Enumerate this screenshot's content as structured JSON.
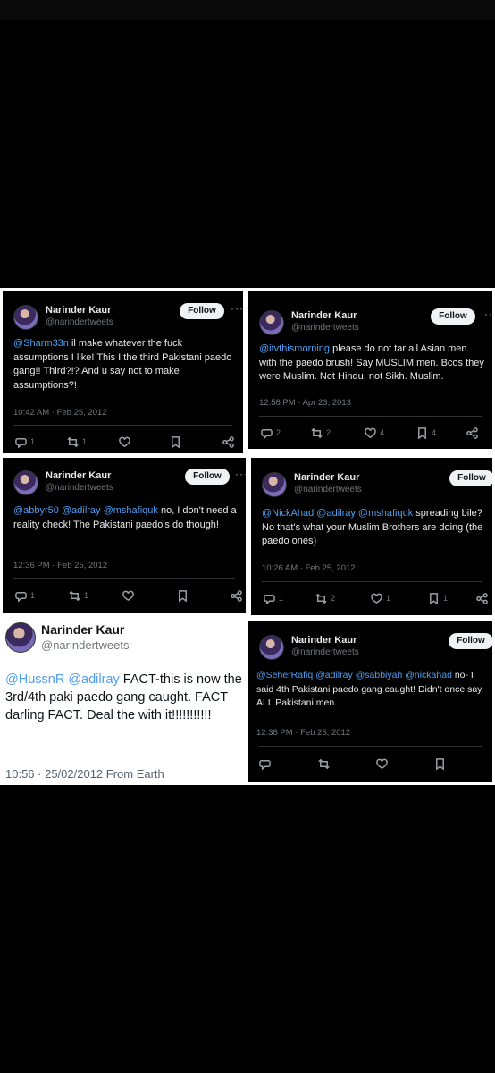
{
  "tweets": [
    {
      "name": "Narinder Kaur",
      "handle": "@narindertweets",
      "follow": "Follow",
      "more": "···",
      "mention": "@Sharm33n",
      "text": " il make whatever the fuck assumptions I like! This I the third Pakistani paedo gang!! Third?!? And u say not to make assumptions?!",
      "timestamp": "10:42 AM · Feb 25, 2012",
      "replies": "1",
      "retweets": "1",
      "likes": "",
      "bookmarks": ""
    },
    {
      "name": "Narinder Kaur",
      "handle": "@narindertweets",
      "follow": "Follow",
      "more": "···",
      "mention": "@itvthismorning",
      "text": " please do not tar all Asian men with the paedo brush! Say MUSLIM men. Bcos they were Muslim. Not Hindu, not Sikh. Muslim.",
      "timestamp": "12:58 PM · Apr 23, 2013",
      "replies": "2",
      "retweets": "2",
      "likes": "4",
      "bookmarks": "4"
    },
    {
      "name": "Narinder Kaur",
      "handle": "@narindertweets",
      "follow": "Follow",
      "more": "···",
      "mention": "@abbyr50 @adilray @mshafiquk",
      "text": " no, I don't need a reality check! The Pakistani paedo's do though!",
      "timestamp": "12:36 PM · Feb 25, 2012",
      "replies": "1",
      "retweets": "1",
      "likes": "",
      "bookmarks": ""
    },
    {
      "name": "Narinder Kaur",
      "handle": "@narindertweets",
      "follow": "Follow",
      "more": "",
      "mention": "@NickAhad @adilray @mshafiquk",
      "text": " spreading bile? No that's what your Muslim Brothers are doing (the paedo ones)",
      "timestamp": "10:26 AM · Feb 25, 2012",
      "replies": "1",
      "retweets": "2",
      "likes": "1",
      "bookmarks": "1"
    },
    {
      "name": "Narinder Kaur",
      "handle": "@narindertweets",
      "mention": "@HussnR @adilray",
      "text": " FACT-this is now the 3rd/4th paki paedo gang caught. FACT darling FACT. Deal the with it!!!!!!!!!!!",
      "timestamp": "10:56 · 25/02/2012 From Earth"
    },
    {
      "name": "Narinder Kaur",
      "handle": "@narindertweets",
      "follow": "Follow",
      "more": "",
      "mention": "@SeherRafiq @adilray @sabbiyah @nickahad",
      "text": " no- I said 4th Pakistani paedo gang caught! Didn't once say ALL Pakistani men.",
      "timestamp": "12:38 PM · Feb 25, 2012",
      "replies": "",
      "retweets": "",
      "likes": "",
      "bookmarks": ""
    }
  ]
}
